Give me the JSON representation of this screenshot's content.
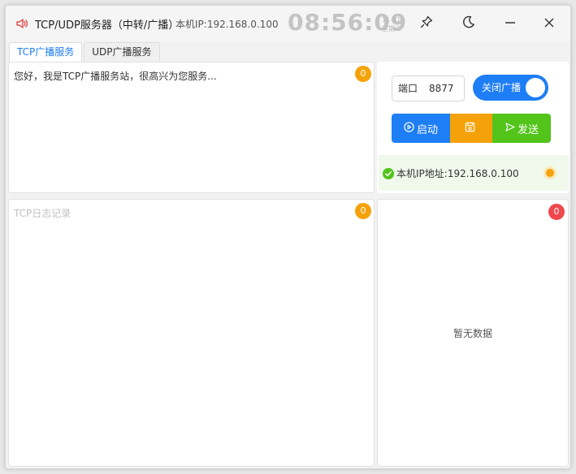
{
  "window": {
    "title": "TCP/UDP服务器（中转/广播）",
    "ip_label": "本机IP:192.168.0.100",
    "clock": "08:56:09",
    "date": "11-11",
    "weekday": "星期二"
  },
  "tabs": [
    {
      "label": "TCP广播服务",
      "active": true
    },
    {
      "label": "UDP广播服务",
      "active": false
    }
  ],
  "message_panel": {
    "text": "您好，我是TCP广播服务站，很高兴为您服务...",
    "badge": "0"
  },
  "log_panel": {
    "placeholder": "TCP日志记录",
    "badge": "0"
  },
  "controls": {
    "port_label": "端口",
    "port_value": "8877",
    "toggle_label": "关闭广播",
    "start_label": "启动",
    "send_label": "发送"
  },
  "status": {
    "ip_text": "本机IP地址:192.168.0.100"
  },
  "client_panel": {
    "badge": "0",
    "empty_text": "暂无数据"
  },
  "colors": {
    "accent": "#1e7ef5",
    "warning": "#f5a20a",
    "success": "#52c41a",
    "danger": "#f0484c"
  },
  "icons": [
    "speaker-icon",
    "pin-icon",
    "moon-icon",
    "minimize-icon",
    "close-icon",
    "play-circle-icon",
    "save-icon",
    "send-icon",
    "check-circle-icon",
    "status-dot-icon"
  ]
}
